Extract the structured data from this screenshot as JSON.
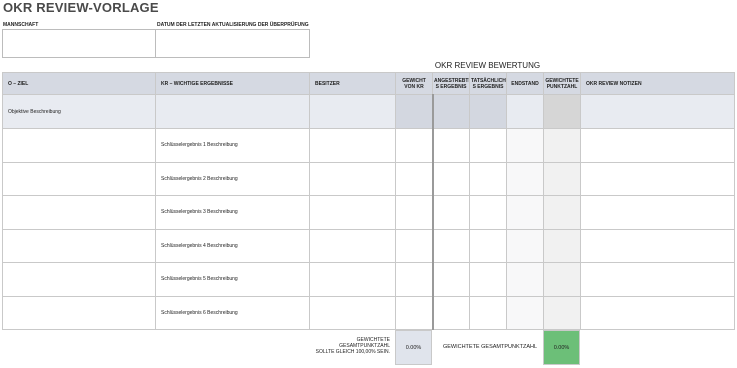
{
  "title": "OKR REVIEW-VORLAGE",
  "labels": {
    "team": "MANNSCHAFT",
    "last_update": "DATUM DER LETZTEN AKTUALISIERUNG DER ÜBERPRÜFUNG"
  },
  "section_title": "OKR REVIEW BEWERTUNG",
  "columns": {
    "objective": "O – ZIEL",
    "key_results": "KR – WICHTIGE ERGEBNISSE",
    "owner": "BESITZER",
    "weight": "GEWICHT VON KR",
    "target": "ANGESTREBTE S ERGEBNIS",
    "actual": "TATSÄCHLICHE S ERGEBNIS",
    "end_state": "ENDSTAND",
    "weighted_score": "GEWICHTETE PUNKTZAHL",
    "notes": "OKR REVIEW NOTIZEN"
  },
  "objective_row": {
    "description": "Objektive Beschreibung"
  },
  "key_results": [
    "Schlüsselergebnis 1 Beschreibung",
    "Schlüsselergebnis 2 Beschreibung",
    "Schlüsselergebnis 3 Beschreibung",
    "Schlüsselergebnis 4 Beschreibung",
    "Schlüsselergebnis 5 Beschreibung",
    "Schlüsselergebnis 6 Beschreibung"
  ],
  "footer": {
    "weight_note_line1": "GEWICHTETE",
    "weight_note_line2": "GESAMTPUNKTZAHL",
    "weight_note_line3": "SOLLTE GLEICH 100,00% SEIN.",
    "weight_total": "0.00%",
    "score_label": "GEWICHTETE GESAMTPUNKTZAHL",
    "score_total": "0.00%",
    "score_color": "#6cbf78"
  }
}
